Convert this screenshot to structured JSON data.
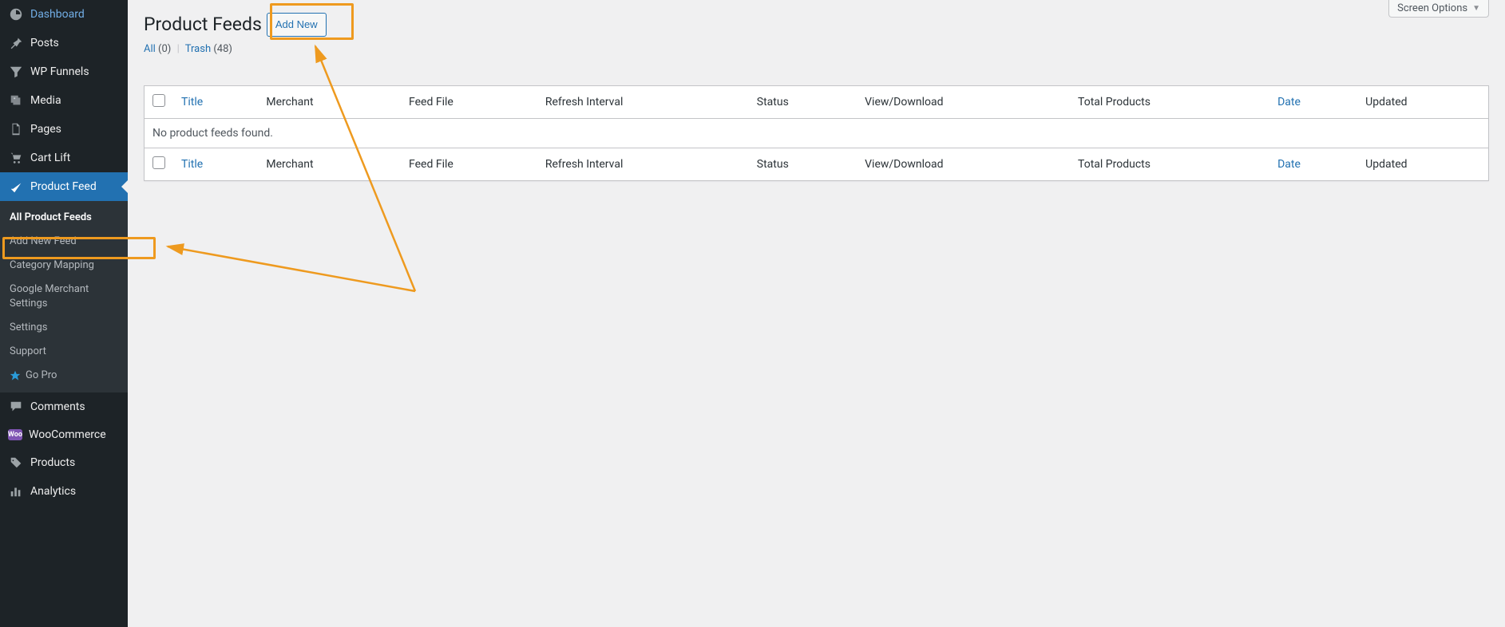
{
  "sidebar": {
    "items": [
      {
        "label": "Dashboard",
        "icon": "dashboard-icon"
      },
      {
        "label": "Posts",
        "icon": "pin-icon"
      },
      {
        "label": "WP Funnels",
        "icon": "funnel-icon"
      },
      {
        "label": "Media",
        "icon": "media-icon"
      },
      {
        "label": "Pages",
        "icon": "pages-icon"
      },
      {
        "label": "Cart Lift",
        "icon": "cart-icon"
      },
      {
        "label": "Product Feed",
        "icon": "feed-icon"
      },
      {
        "label": "Comments",
        "icon": "comments-icon"
      },
      {
        "label": "WooCommerce",
        "icon": "woo-icon"
      },
      {
        "label": "Products",
        "icon": "products-icon"
      },
      {
        "label": "Analytics",
        "icon": "analytics-icon"
      }
    ],
    "submenu": {
      "items": [
        "All Product Feeds",
        "Add New Feed",
        "Category Mapping",
        "Google Merchant Settings",
        "Settings",
        "Support",
        "Go Pro"
      ]
    }
  },
  "screen_options": {
    "label": "Screen Options"
  },
  "page": {
    "title": "Product Feeds",
    "add_new": "Add New"
  },
  "filters": {
    "all_label": "All",
    "all_count": "(0)",
    "trash_label": "Trash",
    "trash_count": "(48)"
  },
  "table": {
    "columns": {
      "title": "Title",
      "merchant": "Merchant",
      "feed_file": "Feed File",
      "refresh_interval": "Refresh Interval",
      "status": "Status",
      "view_download": "View/Download",
      "total_products": "Total Products",
      "date": "Date",
      "updated": "Updated"
    },
    "empty": "No product feeds found."
  }
}
